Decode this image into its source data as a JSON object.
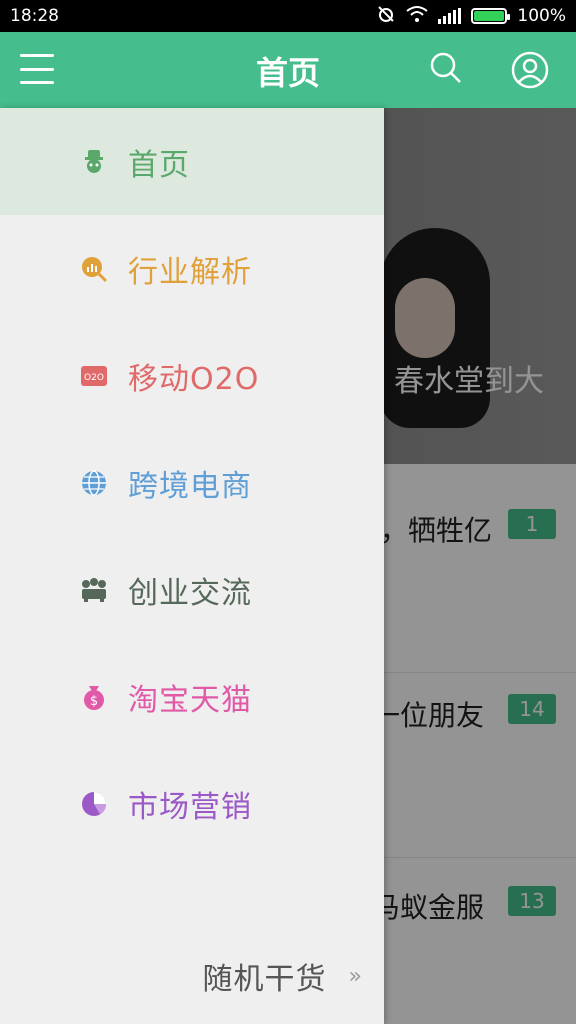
{
  "status_bar": {
    "time": "18:28",
    "battery": "100%",
    "battery_level": 1.0
  },
  "app_bar": {
    "title": "首页",
    "menu_icon": "hamburger-icon",
    "search_icon": "search-icon",
    "profile_icon": "user-icon"
  },
  "content": {
    "hero_caption": "春水堂到大",
    "feed": [
      {
        "title": "，牺牲亿",
        "count": "1"
      },
      {
        "title": "一位朋友",
        "count": "14"
      },
      {
        "title": "马蚁金服",
        "count": "13"
      }
    ]
  },
  "drawer": {
    "items": [
      {
        "label": "首页",
        "icon": "home-mascot-icon",
        "color": "#5aa86a",
        "active": true
      },
      {
        "label": "行业解析",
        "icon": "chart-magnifier-icon",
        "color": "#e0a13a"
      },
      {
        "label": "移动O2O",
        "icon": "o2o-badge-icon",
        "color": "#e06a6a"
      },
      {
        "label": "跨境电商",
        "icon": "globe-icon",
        "color": "#5f9fd6"
      },
      {
        "label": "创业交流",
        "icon": "team-icon",
        "color": "#56685a"
      },
      {
        "label": "淘宝天猫",
        "icon": "money-bag-icon",
        "color": "#e05aa8"
      },
      {
        "label": "市场营销",
        "icon": "pie-chart-icon",
        "color": "#9b59c7"
      }
    ],
    "footer": {
      "label": "随机干货",
      "chevron": "»"
    }
  }
}
